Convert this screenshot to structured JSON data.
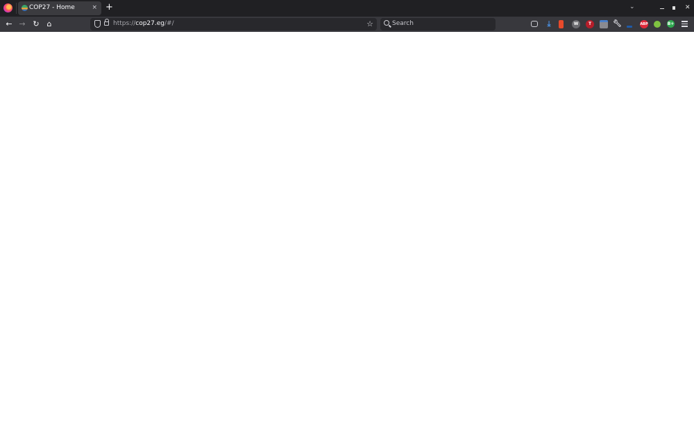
{
  "browser": {
    "tabs": [
      {
        "title": "COP27 - Home",
        "active": true
      }
    ],
    "new_tab_label": "+",
    "tab_close_label": "×",
    "url": {
      "scheme": "https://",
      "host": "cop27.eg",
      "path": "/#/"
    },
    "search_placeholder": "Search",
    "nav_icons": {
      "back": "←",
      "forward": "→",
      "reload": "↻",
      "home": "⌂",
      "bookmark": "☆"
    },
    "extensions": [
      {
        "name": "pocket",
        "label": "",
        "color": "#38383d"
      },
      {
        "name": "downloads",
        "label": "↓",
        "color": "#38383d"
      },
      {
        "name": "extension-red-tag",
        "label": "",
        "color": "#e84a2b"
      },
      {
        "name": "extension-w",
        "label": "W",
        "color": "#6b6b70"
      },
      {
        "name": "extension-t",
        "label": "T",
        "color": "#b51d2a"
      },
      {
        "name": "extension-blue-badge",
        "label": "",
        "color": "#4a7fc9"
      },
      {
        "name": "tools",
        "label": "",
        "color": "#38383d"
      },
      {
        "name": "extension-blue-bar",
        "label": "",
        "color": "#1e5aa8"
      },
      {
        "name": "adblock-plus",
        "label": "ABP",
        "color": "#e0293a"
      },
      {
        "name": "extension-green-dot",
        "label": "",
        "color": "#7fc241"
      },
      {
        "name": "extension-b-plus",
        "label": "B+",
        "color": "#2fa84f"
      }
    ]
  },
  "page": {
    "content": ""
  }
}
